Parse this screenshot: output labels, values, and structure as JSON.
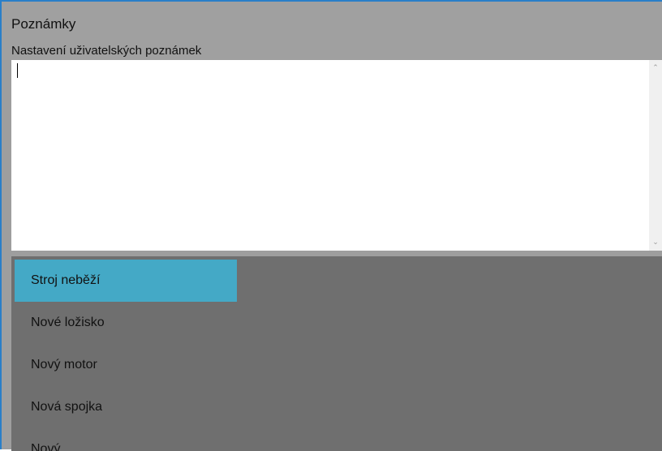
{
  "header": {
    "title": "Poznámky",
    "subtitle": "Nastavení uživatelských poznámek"
  },
  "notes": {
    "value": ""
  },
  "icons": {
    "scroll_up": "chevron-up-icon",
    "scroll_down": "chevron-down-icon"
  },
  "colors": {
    "accent_border": "#2a7fc8",
    "selected_item": "#44a9c6",
    "header_bg": "#a0a0a0",
    "list_bg": "#6f6f6f"
  },
  "notes_list": {
    "selected_index": 0,
    "items": [
      {
        "label": "Stroj neběží"
      },
      {
        "label": "Nové ložisko"
      },
      {
        "label": "Nový motor"
      },
      {
        "label": "Nová spojka"
      },
      {
        "label": "Nový..."
      }
    ]
  }
}
